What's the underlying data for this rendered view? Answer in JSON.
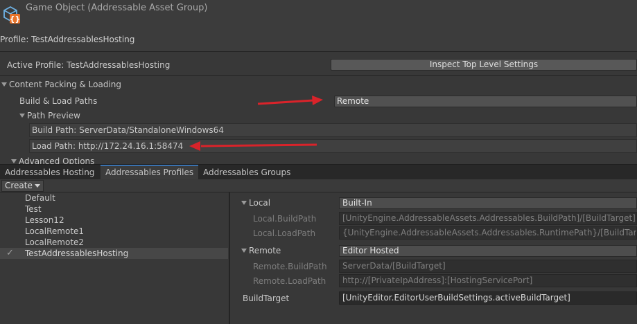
{
  "inspector": {
    "title": "Game Object (Addressable Asset Group)",
    "profile_line": "Profile: TestAddressablesHosting",
    "active_profile_label": "Active Profile: TestAddressablesHosting",
    "inspect_button": "Inspect Top Level Settings",
    "content_packing_label": "Content Packing & Loading",
    "build_load_paths_label": "Build & Load Paths",
    "build_load_paths_value": "Remote",
    "path_preview_label": "Path Preview",
    "build_path": "Build Path: ServerData/StandaloneWindows64",
    "load_path": "Load Path: http://172.24.16.1:58474",
    "advanced_options_label": "Advanced Options"
  },
  "tabs": [
    {
      "label": "Addressables Hosting",
      "active": false
    },
    {
      "label": "Addressables Profiles",
      "active": true
    },
    {
      "label": "Addressables Groups",
      "active": false
    }
  ],
  "toolbar": {
    "create_label": "Create"
  },
  "profiles": [
    {
      "name": "Default",
      "selected": false
    },
    {
      "name": "Test",
      "selected": false
    },
    {
      "name": "Lesson12",
      "selected": false
    },
    {
      "name": "LocalRemote1",
      "selected": false
    },
    {
      "name": "LocalRemote2",
      "selected": false
    },
    {
      "name": "TestAddressablesHosting",
      "selected": true
    }
  ],
  "profile_detail": {
    "local": {
      "label": "Local",
      "value": "Built-In",
      "build_path_label": "Local.BuildPath",
      "build_path_value": "[UnityEngine.AddressableAssets.Addressables.BuildPath]/[BuildTarget]",
      "load_path_label": "Local.LoadPath",
      "load_path_value": "{UnityEngine.AddressableAssets.Addressables.RuntimePath}/[BuildTarget]"
    },
    "remote": {
      "label": "Remote",
      "value": "Editor Hosted",
      "build_path_label": "Remote.BuildPath",
      "build_path_value": "ServerData/[BuildTarget]",
      "load_path_label": "Remote.LoadPath",
      "load_path_value": "http://[PrivateIpAddress]:[HostingServicePort]"
    },
    "build_target_label": "BuildTarget",
    "build_target_value": "[UnityEditor.EditorUserBuildSettings.activeBuildTarget]"
  },
  "colors": {
    "annotation_arrow": "#d9232a",
    "active_tab_accent": "#3a72b0"
  },
  "icons": {
    "object": "addressable-group-icon",
    "check": "check-icon"
  }
}
